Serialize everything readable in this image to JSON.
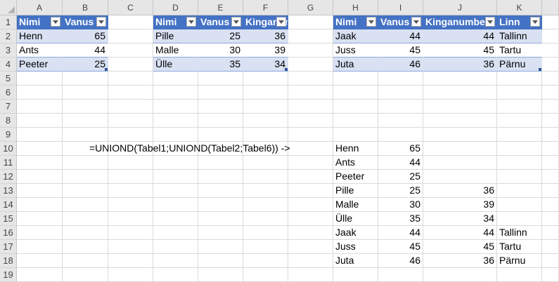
{
  "columns": [
    "A",
    "B",
    "C",
    "D",
    "E",
    "F",
    "G",
    "H",
    "I",
    "J",
    "K"
  ],
  "rows": [
    "1",
    "2",
    "3",
    "4",
    "5",
    "6",
    "7",
    "8",
    "9",
    "10",
    "11",
    "12",
    "13",
    "14",
    "15",
    "16",
    "17",
    "18",
    "19"
  ],
  "table1": {
    "headers": [
      "Nimi",
      "Vanus"
    ],
    "rows": [
      [
        "Henn",
        "65"
      ],
      [
        "Ants",
        "44"
      ],
      [
        "Peeter",
        "25"
      ]
    ]
  },
  "table2": {
    "headers": [
      "Nimi",
      "Vanus",
      "Kinganumber"
    ],
    "rows": [
      [
        "Pille",
        "25",
        "36"
      ],
      [
        "Malle",
        "30",
        "39"
      ],
      [
        "Ülle",
        "35",
        "34"
      ]
    ]
  },
  "table6": {
    "headers": [
      "Nimi",
      "Vanus",
      "Kinganumber",
      "Linn"
    ],
    "rows": [
      [
        "Jaak",
        "44",
        "44",
        "Tallinn"
      ],
      [
        "Juss",
        "45",
        "45",
        "Tartu"
      ],
      [
        "Juta",
        "46",
        "36",
        "Pärnu"
      ]
    ]
  },
  "formula_text": "=UNIOND(Tabel1;UNIOND(Tabel2;Tabel6))  ->",
  "result": [
    [
      "Henn",
      "65",
      "",
      ""
    ],
    [
      "Ants",
      "44",
      "",
      ""
    ],
    [
      "Peeter",
      "25",
      "",
      ""
    ],
    [
      "Pille",
      "25",
      "36",
      ""
    ],
    [
      "Malle",
      "30",
      "39",
      ""
    ],
    [
      "Ülle",
      "35",
      "34",
      ""
    ],
    [
      "Jaak",
      "44",
      "44",
      "Tallinn"
    ],
    [
      "Juss",
      "45",
      "45",
      "Tartu"
    ],
    [
      "Juta",
      "46",
      "36",
      "Pärnu"
    ]
  ],
  "colors": {
    "table_header": "#4472c4",
    "table_band": "#d9e1f2",
    "grid": "#dadada"
  }
}
